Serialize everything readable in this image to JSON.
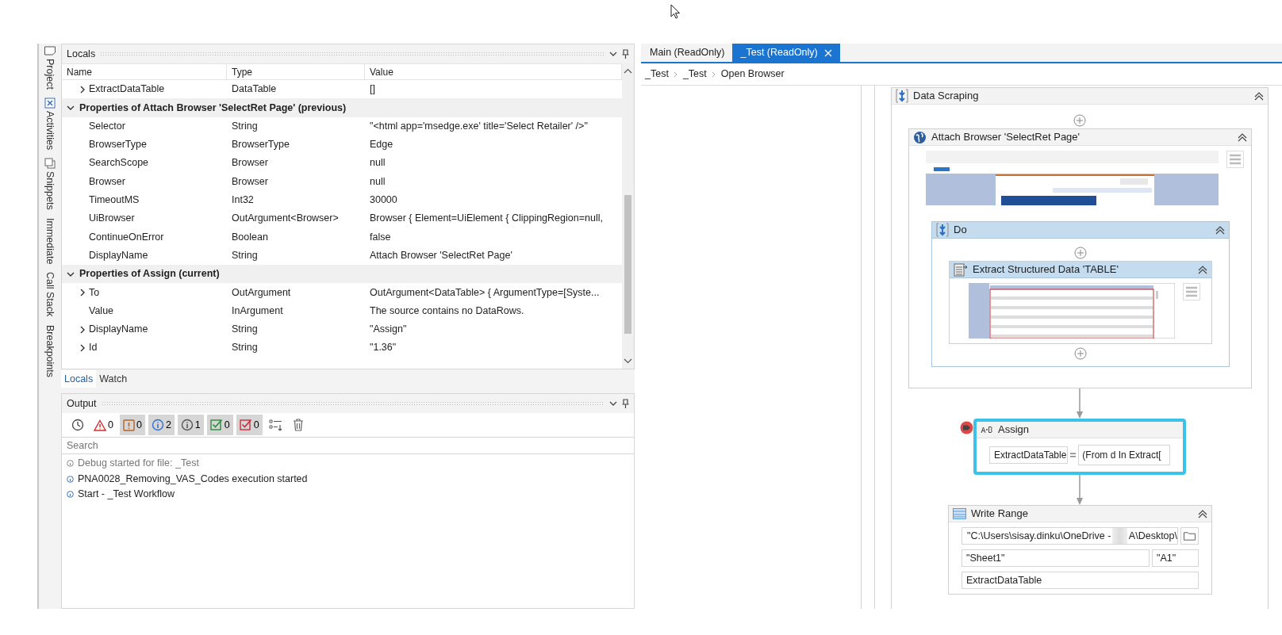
{
  "side_tabs": [
    {
      "label": "Project"
    },
    {
      "label": "Activities"
    },
    {
      "label": "Snippets"
    },
    {
      "label": "Immediate"
    },
    {
      "label": "Call Stack"
    },
    {
      "label": "Breakpoints"
    }
  ],
  "locals": {
    "title": "Locals",
    "columns": [
      "Name",
      "Type",
      "Value"
    ],
    "rows": [
      {
        "kind": "row",
        "expandable": true,
        "name": "ExtractDataTable",
        "type": "DataTable",
        "value": "[]"
      },
      {
        "kind": "group",
        "expanded": true,
        "label": "Properties of Attach Browser 'SelectRet Page' (previous)"
      },
      {
        "kind": "row",
        "expandable": false,
        "name": "Selector",
        "type": "String",
        "value": "\"<html app='msedge.exe' title='Select Retailer' />\""
      },
      {
        "kind": "row",
        "expandable": false,
        "name": "BrowserType",
        "type": "BrowserType",
        "value": "Edge"
      },
      {
        "kind": "row",
        "expandable": false,
        "name": "SearchScope",
        "type": "Browser",
        "value": "null"
      },
      {
        "kind": "row",
        "expandable": false,
        "name": "Browser",
        "type": "Browser",
        "value": "null"
      },
      {
        "kind": "row",
        "expandable": false,
        "name": "TimeoutMS",
        "type": "Int32",
        "value": "30000"
      },
      {
        "kind": "row",
        "expandable": false,
        "name": "UiBrowser",
        "type": "OutArgument<Browser>",
        "value": "Browser { Element=UiElement { ClippingRegion=null,"
      },
      {
        "kind": "row",
        "expandable": false,
        "name": "ContinueOnError",
        "type": "Boolean",
        "value": "false"
      },
      {
        "kind": "row",
        "expandable": false,
        "name": "DisplayName",
        "type": "String",
        "value": "Attach Browser 'SelectRet Page'"
      },
      {
        "kind": "group",
        "expanded": true,
        "label": "Properties of Assign (current)"
      },
      {
        "kind": "row",
        "expandable": true,
        "name": "To",
        "type": "OutArgument",
        "value": "OutArgument<DataTable> { ArgumentType=[Syste..."
      },
      {
        "kind": "row",
        "expandable": false,
        "name": "Value",
        "type": "InArgument",
        "value": "The source contains no DataRows."
      },
      {
        "kind": "row",
        "expandable": true,
        "name": "DisplayName",
        "type": "String",
        "value": "\"Assign\""
      },
      {
        "kind": "row",
        "expandable": true,
        "name": "Id",
        "type": "String",
        "value": "\"1.36\""
      }
    ],
    "tabs": [
      {
        "label": "Locals",
        "selected": true
      },
      {
        "label": "Watch",
        "selected": false
      }
    ]
  },
  "output": {
    "title": "Output",
    "filters": [
      {
        "kind": "clock",
        "selected": false
      },
      {
        "kind": "warning",
        "count": "0",
        "selected": false
      },
      {
        "kind": "error",
        "count": "0",
        "selected": true
      },
      {
        "kind": "info",
        "count": "2",
        "selected": true
      },
      {
        "kind": "trace",
        "count": "1",
        "selected": true
      },
      {
        "kind": "success",
        "count": "0",
        "selected": true
      },
      {
        "kind": "failure",
        "count": "0",
        "selected": true
      },
      {
        "kind": "list",
        "selected": false
      },
      {
        "kind": "clear",
        "selected": false
      }
    ],
    "search": {
      "placeholder": "Search"
    },
    "lines": [
      {
        "text": "Debug started for file: _Test",
        "muted": true
      },
      {
        "text": "PNA0028_Removing_VAS_Codes execution started",
        "muted": false
      },
      {
        "text": "Start - _Test Workflow",
        "muted": false
      }
    ]
  },
  "designer": {
    "tabs": [
      {
        "label": "Main (ReadOnly)",
        "selected": false,
        "closable": false
      },
      {
        "label": "_Test (ReadOnly)",
        "selected": true,
        "closable": true
      }
    ],
    "breadcrumb": [
      "_Test",
      "_Test",
      "Open Browser"
    ],
    "data_scraping": {
      "title": "Data Scraping"
    },
    "attach_browser": {
      "title": "Attach Browser 'SelectRet Page'"
    },
    "do": {
      "title": "Do"
    },
    "extract": {
      "title": "Extract Structured Data 'TABLE'"
    },
    "assign": {
      "title": "Assign",
      "selected": true,
      "breakpoint": true,
      "to": "ExtractDataTable",
      "value": "(From d In Extract["
    },
    "write_range": {
      "title": "Write Range",
      "path_start": "\"C:\\Users\\sisay.dinku\\OneDrive -",
      "path_end": "A\\Desktop\\",
      "sheet": "\"Sheet1\"",
      "cell": "\"A1\"",
      "table": "ExtractDataTable"
    }
  }
}
